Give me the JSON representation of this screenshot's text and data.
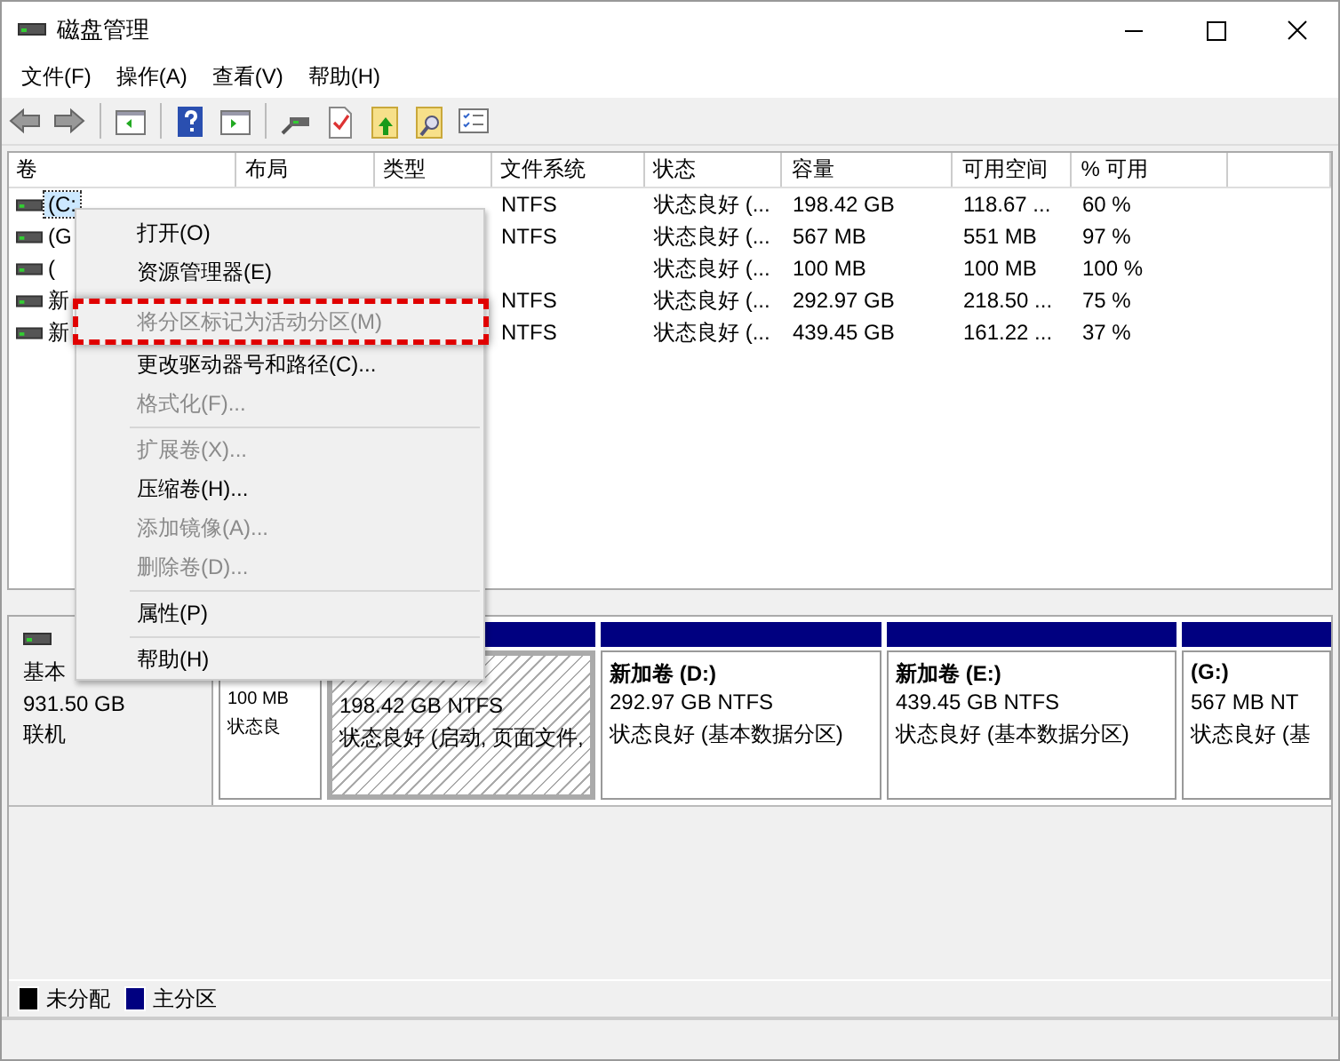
{
  "window": {
    "title": "磁盘管理"
  },
  "menu": [
    "文件(F)",
    "操作(A)",
    "查看(V)",
    "帮助(H)"
  ],
  "columns": [
    "卷",
    "布局",
    "类型",
    "文件系统",
    "状态",
    "容量",
    "可用空间",
    "% 可用"
  ],
  "rows": [
    {
      "selected": true,
      "volume": "(C:",
      "fs": "NTFS",
      "status": "状态良好 (...",
      "capacity": "198.42 GB",
      "free": "118.67 ...",
      "pct": "60 %"
    },
    {
      "selected": false,
      "volume": "(G",
      "fs": "NTFS",
      "status": "状态良好 (...",
      "capacity": "567 MB",
      "free": "551 MB",
      "pct": "97 %"
    },
    {
      "selected": false,
      "volume": "(",
      "status": "状态良好 (...",
      "capacity": "100 MB",
      "free": "100 MB",
      "pct": "100 %"
    },
    {
      "selected": false,
      "volume": "新",
      "fs": "NTFS",
      "status": "状态良好 (...",
      "capacity": "292.97 GB",
      "free": "218.50 ...",
      "pct": "75 %"
    },
    {
      "selected": false,
      "volume": "新",
      "fs": "NTFS",
      "status": "状态良好 (...",
      "capacity": "439.45 GB",
      "free": "161.22 ...",
      "pct": "37 %"
    }
  ],
  "disk": {
    "kind_label": "基本",
    "size": "931.50 GB",
    "state": "联机"
  },
  "partitions": [
    {
      "selected": false,
      "size": "100 MB",
      "status": "状态良"
    },
    {
      "selected": true,
      "size": "198.42 GB NTFS",
      "status": "状态良好 (启动, 页面文件,"
    },
    {
      "selected": false,
      "name": "新加卷 (D:)",
      "size": "292.97 GB NTFS",
      "status": "状态良好 (基本数据分区)"
    },
    {
      "selected": false,
      "name": "新加卷 (E:)",
      "size": "439.45 GB NTFS",
      "status": "状态良好 (基本数据分区)"
    },
    {
      "selected": false,
      "name": "(G:)",
      "size": "567 MB NT",
      "status": "状态良好 (基"
    }
  ],
  "context_menu": [
    {
      "kind": "item",
      "label": "打开(O)",
      "disabled": false,
      "highlighted": false
    },
    {
      "kind": "item",
      "label": "资源管理器(E)",
      "disabled": false,
      "highlighted": false
    },
    {
      "kind": "item",
      "label": "将分区标记为活动分区(M)",
      "disabled": true,
      "highlighted": true
    },
    {
      "kind": "item",
      "label": "更改驱动器号和路径(C)...",
      "disabled": false,
      "highlighted": false
    },
    {
      "kind": "item",
      "label": "格式化(F)...",
      "disabled": true,
      "highlighted": false
    },
    {
      "kind": "separator"
    },
    {
      "kind": "item",
      "label": "扩展卷(X)...",
      "disabled": true,
      "highlighted": false
    },
    {
      "kind": "item",
      "label": "压缩卷(H)...",
      "disabled": false,
      "highlighted": false
    },
    {
      "kind": "item",
      "label": "添加镜像(A)...",
      "disabled": true,
      "highlighted": false
    },
    {
      "kind": "item",
      "label": "删除卷(D)...",
      "disabled": true,
      "highlighted": false
    },
    {
      "kind": "separator"
    },
    {
      "kind": "item",
      "label": "属性(P)",
      "disabled": false,
      "highlighted": false
    },
    {
      "kind": "separator"
    },
    {
      "kind": "item",
      "label": "帮助(H)",
      "disabled": false,
      "highlighted": false
    }
  ],
  "legend": [
    {
      "label": "未分配",
      "color": "#000000"
    },
    {
      "label": "主分区",
      "color": "#000080"
    }
  ]
}
